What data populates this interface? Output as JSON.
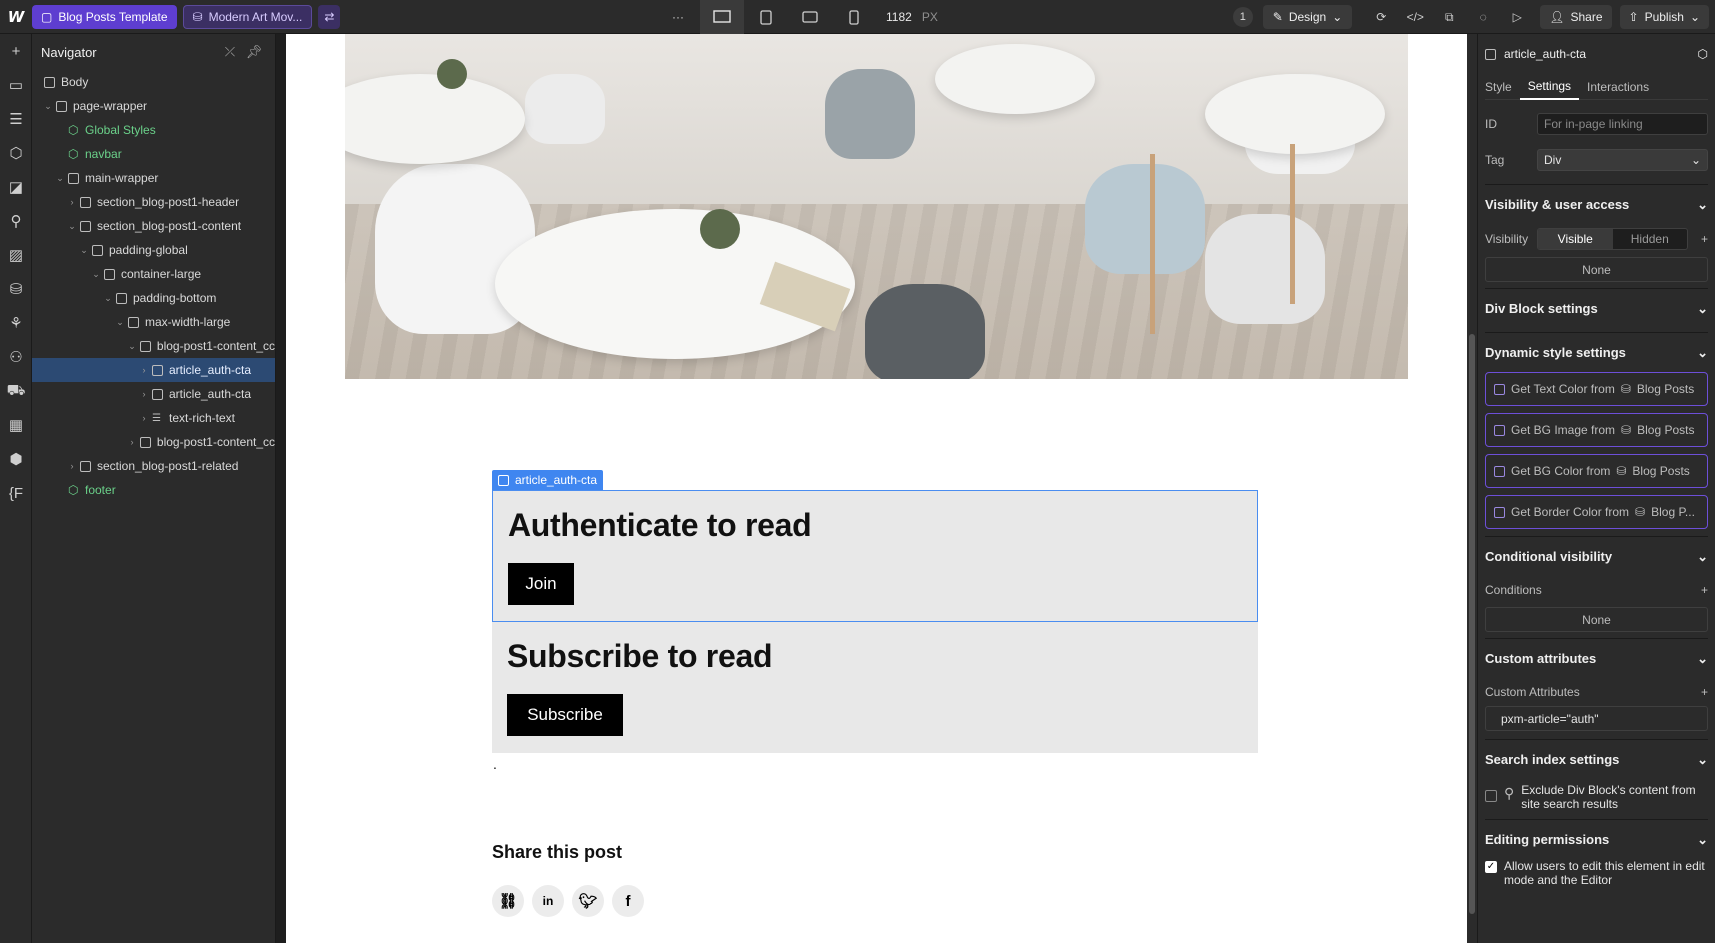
{
  "topbar": {
    "tabs": [
      {
        "label": "Blog Posts Template"
      },
      {
        "label": "Modern Art Mov..."
      }
    ],
    "width_value": "1182",
    "width_unit": "PX",
    "users_count": "1",
    "mode_label": "Design",
    "share_label": "Share",
    "publish_label": "Publish"
  },
  "navigator": {
    "title": "Navigator",
    "items": [
      {
        "label": "Body"
      },
      {
        "label": "page-wrapper"
      },
      {
        "label": "Global Styles"
      },
      {
        "label": "navbar"
      },
      {
        "label": "main-wrapper"
      },
      {
        "label": "section_blog-post1-header"
      },
      {
        "label": "section_blog-post1-content"
      },
      {
        "label": "padding-global"
      },
      {
        "label": "container-large"
      },
      {
        "label": "padding-bottom"
      },
      {
        "label": "max-width-large"
      },
      {
        "label": "blog-post1-content_cc"
      },
      {
        "label": "article_auth-cta"
      },
      {
        "label": "article_auth-cta"
      },
      {
        "label": "text-rich-text"
      },
      {
        "label": "blog-post1-content_cc"
      },
      {
        "label": "section_blog-post1-related"
      },
      {
        "label": "footer"
      }
    ]
  },
  "canvas": {
    "selected_tag": "article_auth-cta",
    "cta1_heading": "Authenticate to read",
    "cta1_button": "Join",
    "cta2_heading": "Subscribe to read",
    "cta2_button": "Subscribe",
    "dot": ".",
    "share_title": "Share this post"
  },
  "settings": {
    "element_name": "article_auth-cta",
    "tabs": [
      {
        "label": "Style"
      },
      {
        "label": "Settings"
      },
      {
        "label": "Interactions"
      }
    ],
    "id_label": "ID",
    "id_placeholder": "For in-page linking",
    "tag_label": "Tag",
    "tag_value": "Div",
    "visibility_section": "Visibility & user access",
    "visibility_label": "Visibility",
    "visible_option": "Visible",
    "hidden_option": "Hidden",
    "visibility_none": "None",
    "divblock_section": "Div Block settings",
    "dynamic_section": "Dynamic style settings",
    "dynamic_items": [
      {
        "label": "Get Text Color from",
        "source": "Blog Posts"
      },
      {
        "label": "Get BG Image from",
        "source": "Blog Posts"
      },
      {
        "label": "Get BG Color from",
        "source": "Blog Posts"
      },
      {
        "label": "Get Border Color from",
        "source": "Blog P..."
      }
    ],
    "conditional_section": "Conditional visibility",
    "conditions_label": "Conditions",
    "conditions_none": "None",
    "custom_attr_section": "Custom attributes",
    "custom_attr_label": "Custom Attributes",
    "custom_attr_value": "pxm-article=\"auth\"",
    "search_section": "Search index settings",
    "search_exclude": "Exclude Div Block's content from site search results",
    "editing_section": "Editing permissions",
    "editing_allow": "Allow users to edit this element in edit mode and the Editor"
  },
  "colors": {
    "accent": "#5e3ed0",
    "selection": "#3f86f0",
    "component_green": "#6bd18a"
  }
}
